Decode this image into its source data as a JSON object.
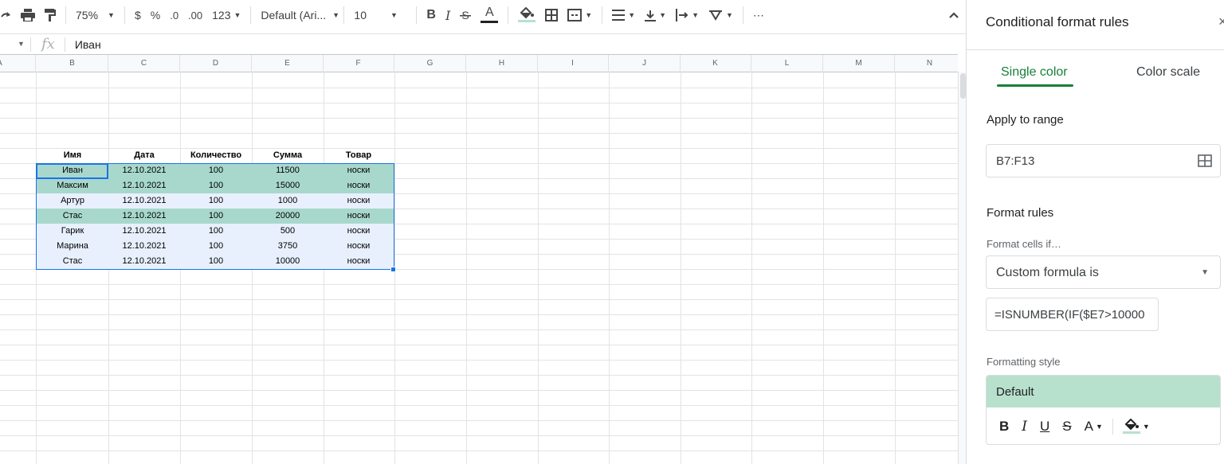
{
  "toolbar": {
    "zoom": "75%",
    "currency": "$",
    "percent": "%",
    "decrease_decimal": ".0",
    "increase_decimal": ".00",
    "number_format": "123",
    "font_family": "Default (Ari...",
    "font_size": "10",
    "bold": "B",
    "italic": "I",
    "text_color_letter": "A",
    "more": "⋯"
  },
  "formula_bar": {
    "fx": "fx",
    "value": "Иван"
  },
  "columns": [
    "A",
    "B",
    "C",
    "D",
    "E",
    "F",
    "G",
    "H",
    "I",
    "J",
    "K",
    "L",
    "M",
    "N"
  ],
  "table": {
    "headers": [
      "Имя",
      "Дата",
      "Количество",
      "Сумма",
      "Товар"
    ],
    "rows": [
      [
        "Иван",
        "12.10.2021",
        "100",
        "11500",
        "носки"
      ],
      [
        "Максим",
        "12.10.2021",
        "100",
        "15000",
        "носки"
      ],
      [
        "Артур",
        "12.10.2021",
        "100",
        "1000",
        "носки"
      ],
      [
        "Стас",
        "12.10.2021",
        "100",
        "20000",
        "носки"
      ],
      [
        "Гарик",
        "12.10.2021",
        "100",
        "500",
        "носки"
      ],
      [
        "Марина",
        "12.10.2021",
        "100",
        "3750",
        "носки"
      ],
      [
        "Стас",
        "12.10.2021",
        "100",
        "10000",
        "носки"
      ]
    ],
    "highlighted_rows": [
      0,
      1,
      3
    ],
    "highlight_color": "#a8d8cc",
    "selection_color": "#e8f0fe"
  },
  "panel": {
    "title": "Conditional format rules",
    "close": "×",
    "tabs": [
      "Single color",
      "Color scale"
    ],
    "apply_to_range_label": "Apply to range",
    "range_value": "B7:F13",
    "format_rules_label": "Format rules",
    "format_cells_if_label": "Format cells if…",
    "condition": "Custom formula is",
    "formula": "=ISNUMBER(IF($E7>10000",
    "formatting_style_label": "Formatting style",
    "style_preview": "Default",
    "style_preview_color": "#b7e1cd",
    "style_buttons": {
      "bold": "B",
      "italic": "I",
      "underline": "U",
      "strike": "S",
      "text_color": "A"
    }
  },
  "colors": {
    "accent_green": "#188038",
    "selection_blue": "#1a73e8"
  }
}
